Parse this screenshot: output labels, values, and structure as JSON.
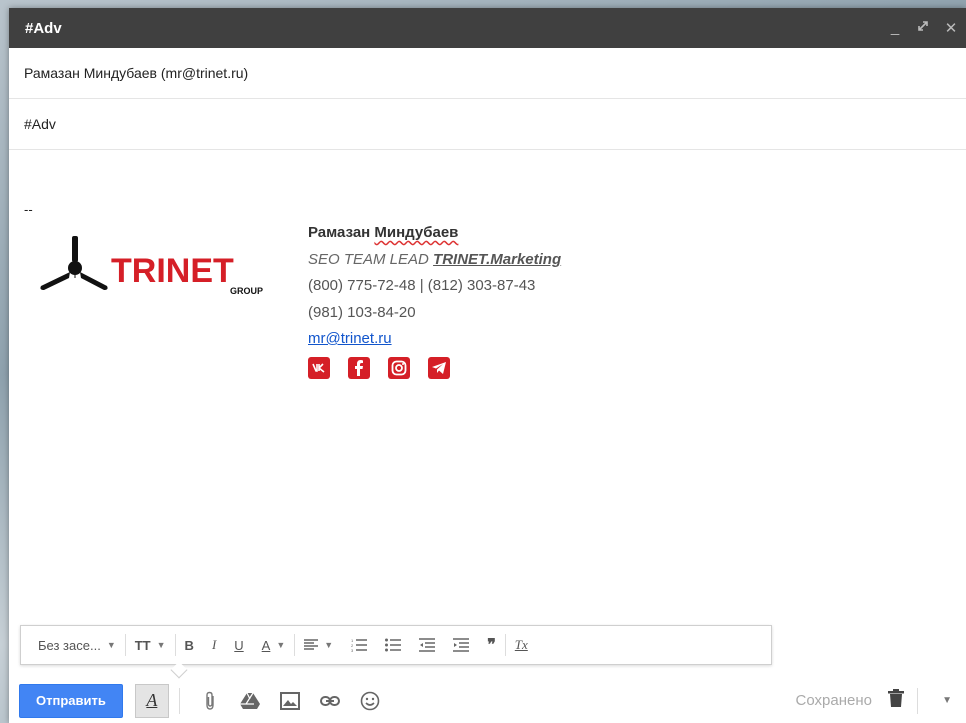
{
  "window": {
    "title": "#Adv",
    "controls": [
      "minimize-icon",
      "expand-icon",
      "close-icon"
    ]
  },
  "to_field": "Рамазан Миндубаев (mr@trinet.ru)",
  "subject_field": "#Adv",
  "signature": {
    "separator": "--",
    "logo_text": "TRINET",
    "logo_subtext": "GROUP",
    "name_first": "Рамазан",
    "name_last": "Миндубаев",
    "role_prefix": "SEO TEAM LEAD ",
    "role_brand": "TRINET.Marketing",
    "phones": "(800) 775-72-48 | (812) 303-87-43",
    "phone2": "(981) 103-84-20",
    "email": "mr@trinet.ru",
    "social_icons": [
      "vk-icon",
      "facebook-icon",
      "instagram-icon",
      "telegram-icon"
    ],
    "brand_color": "#d51f27"
  },
  "format_toolbar": {
    "font": "Без засе...",
    "size_icon": "TT",
    "bold": "B",
    "italic": "I",
    "underline": "U",
    "text_color": "A",
    "clear": "Tx"
  },
  "bottom_bar": {
    "send_label": "Отправить",
    "format_toggle": "A",
    "saved_label": "Сохранено",
    "send_color": "#4285f4"
  }
}
